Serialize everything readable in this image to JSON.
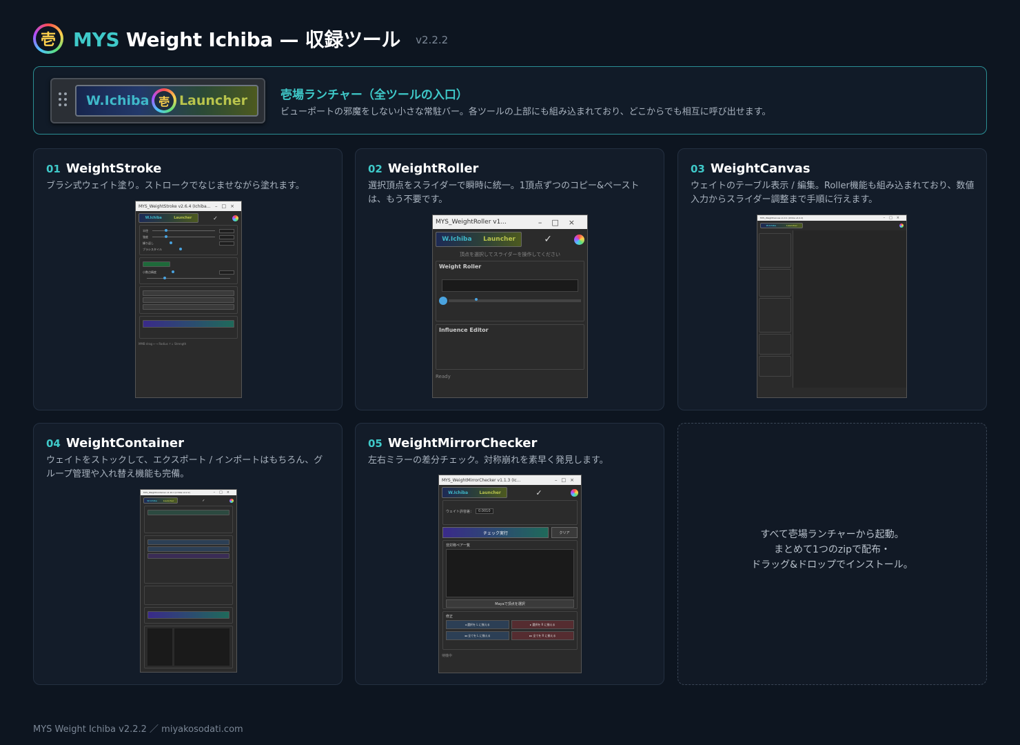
{
  "header": {
    "logo_glyph": "壱",
    "brand": "MYS",
    "title": "Weight Ichiba — 収録ツール",
    "version": "v2.2.2"
  },
  "launcher": {
    "left_label": "W.Ichiba",
    "right_label": "Launcher",
    "logo_glyph": "壱",
    "title": "壱場ランチャー（全ツールの入口）",
    "description": "ビューポートの邪魔をしない小さな常駐バー。各ツールの上部にも組み込まれており、どこからでも相互に呼び出せます。"
  },
  "tools": [
    {
      "num": "01",
      "name": "WeightStroke",
      "description": "ブラシ式ウェイト塗り。ストロークでなじませながら塗れます。",
      "window_title": "MYS_WeightStroke v2.6.4 (Ichiba..."
    },
    {
      "num": "02",
      "name": "WeightRoller",
      "description": "選択頂点をスライダーで瞬時に統一。1頂点ずつのコピー&ペーストは、もう不要です。",
      "window_title": "MYS_WeightRoller v1...",
      "hint": "頂点を選択してスライダーを操作してください",
      "section1": "Weight Roller",
      "section2": "Influence Editor",
      "status": "Ready"
    },
    {
      "num": "03",
      "name": "WeightCanvas",
      "description": "ウェイトのテーブル表示 / 編集。Roller機能も組み込まれており、数値入力からスライダー調整まで手順に行えます。",
      "window_title": "MYS_WeightCanvas v1.0.1 (Ichiba v2.2.2)"
    },
    {
      "num": "04",
      "name": "WeightContainer",
      "description": "ウェイトをストックして、エクスポート / インポートはもちろん、グループ管理や入れ替え機能も完備。",
      "window_title": "MYS_WeightContainer v1.10.1 (Ichiba v2.2.2)"
    },
    {
      "num": "05",
      "name": "WeightMirrorChecker",
      "description": "左右ミラーの差分チェック。対称崩れを素早く発見します。",
      "window_title": "MYS_WeightMirrorChecker v1.1.3 (Ic...",
      "tolerance_label": "ウェイト許容差：",
      "tolerance_value": "0.0010",
      "check_button": "チェック実行",
      "clear_button": "クリア",
      "list_label": "非対称ペア一覧",
      "select_button": "Mayaで頂点を選択",
      "fix_label": "修正",
      "fix_buttons": [
        "◂ 選択を L に揃える",
        "▸ 選択を R に揃える",
        "◂◂ 全てを L に揃える",
        "▸▸ 全てを R に揃える"
      ],
      "status": "待機中"
    }
  ],
  "placeholder_card": {
    "line1": "すべて壱場ランチャーから起動。",
    "line2": "まとめて1つのzipで配布・",
    "line3": "ドラッグ&ドロップでインストール。"
  },
  "footer": {
    "text": "MYS Weight Ichiba v2.2.2 ／ miyakosodati.com"
  }
}
